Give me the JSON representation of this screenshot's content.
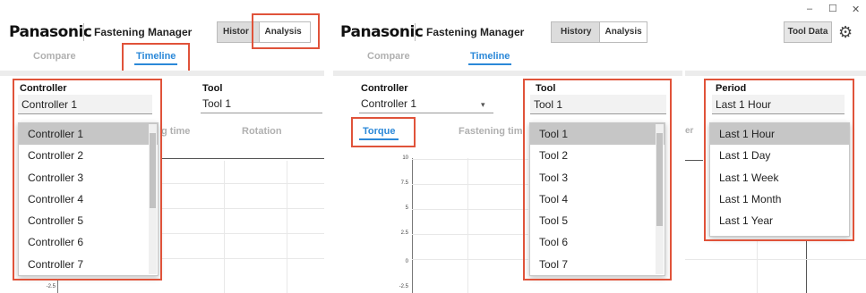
{
  "app": {
    "brand": "Panasonic",
    "title": "Fastening Manager"
  },
  "modes": {
    "history": "History",
    "analysis": "Analysis",
    "history_truncated": "Histor"
  },
  "toolbar": {
    "tool_data": "Tool Data"
  },
  "tabs": {
    "compare": "Compare",
    "timeline": "Timeline"
  },
  "filters": {
    "controller": {
      "label": "Controller",
      "value": "Controller 1"
    },
    "tool": {
      "label": "Tool",
      "value": "Tool 1"
    },
    "period": {
      "label": "Period",
      "value": "Last 1 Hour"
    }
  },
  "subtabs": {
    "torque": "Torque",
    "fastening_time": "Fastening time",
    "fastening_time_truncated": "Fastening tim",
    "rotation": "Rotation",
    "g_time": "g time"
  },
  "controller_options": [
    "Controller 1",
    "Controller 2",
    "Controller 3",
    "Controller 4",
    "Controller 5",
    "Controller 6",
    "Controller 7"
  ],
  "tool_options": [
    "Tool 1",
    "Tool 2",
    "Tool 3",
    "Tool 4",
    "Tool 5",
    "Tool 6",
    "Tool 7"
  ],
  "period_options": [
    "Last 1 Hour",
    "Last 1 Day",
    "Last 1 Week",
    "Last 1 Month",
    "Last 1 Year"
  ],
  "y_ticks": [
    "10",
    "7.5",
    "5",
    "2.5",
    "0",
    "-2.5"
  ],
  "y_ticks_left": [
    "-2.5"
  ],
  "window_controls": {
    "minimize": "–",
    "maximize": "☐",
    "close": "✕"
  },
  "colors": {
    "accent": "#2b88d8",
    "callout": "#e0533a",
    "selected": "#c6c6c6"
  }
}
